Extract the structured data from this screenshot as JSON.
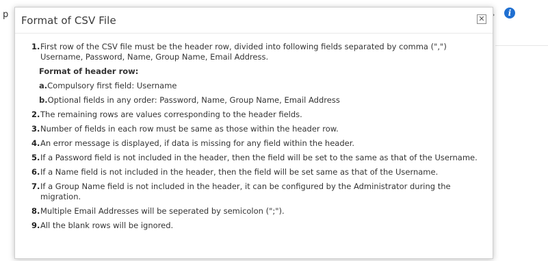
{
  "background": {
    "left_text": "p"
  },
  "modal": {
    "title": "Format of CSV File",
    "close_symbol": "✕",
    "items": [
      {
        "num": "1.",
        "text": "First row of the CSV file must be the header row, divided into following fields separated by comma (\",\")",
        "text2": "Username, Password, Name, Group Name, Email Address."
      },
      {
        "num": "2.",
        "text": "The remaining rows are values corresponding to the header fields."
      },
      {
        "num": "3.",
        "text": "Number of fields in each row must be same as those within the header row."
      },
      {
        "num": "4.",
        "text": "An error message is displayed, if data is missing for any field within the header."
      },
      {
        "num": "5.",
        "text": "If a Password field is not included in the header, then the field will be set to the same as that of the Username."
      },
      {
        "num": "6.",
        "text": "If a Name field is not included in the header, then the field will be set same as that of the Username."
      },
      {
        "num": "7.",
        "text": "If a Group Name field is not included in the header, it can be configured by the Administrator during the migration."
      },
      {
        "num": "8.",
        "text": "Multiple Email Addresses will be seperated by semicolon (\";\")."
      },
      {
        "num": "9.",
        "text": "All the blank rows will be ignored."
      }
    ],
    "header_format": {
      "label": "Format of header row:",
      "a_letter": "a.",
      "a_text": "Compulsory first field: Username",
      "b_letter": "b.",
      "b_text": "Optional fields in any order: Password, Name, Group Name, Email Address"
    }
  },
  "colors": {
    "info_icon": "#1f6fd1",
    "border": "#cfcfcf"
  },
  "icons": {
    "info": "info-icon",
    "close": "close-icon"
  }
}
